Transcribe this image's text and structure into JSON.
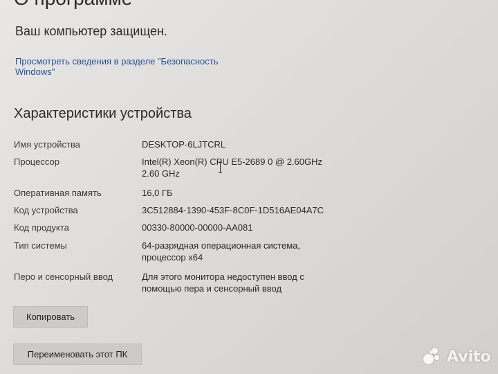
{
  "page": {
    "title": "О программе",
    "protection_status": "Ваш компьютер защищен.",
    "security_link": "Просмотреть сведения в разделе \"Безопасность Windows\""
  },
  "device_specs": {
    "section_title": "Характеристики устройства",
    "rows": [
      {
        "label": "Имя устройства",
        "value": "DESKTOP-6LJTCRL"
      },
      {
        "label": "Процессор",
        "value": "Intel(R) Xeon(R) CPU E5-2689 0 @ 2.60GHz\n2.60 GHz"
      },
      {
        "label": "Оперативная память",
        "value": "16,0 ГБ"
      },
      {
        "label": "Код устройства",
        "value": "3C512884-1390-453F-8C0F-1D516AE04A7C"
      },
      {
        "label": "Код продукта",
        "value": "00330-80000-00000-AA081"
      },
      {
        "label": "Тип системы",
        "value": "64-разрядная операционная система,\nпроцессор x64"
      },
      {
        "label": "Перо и сенсорный ввод",
        "value": "Для этого монитора недоступен ввод с\nпомощью пера и сенсорный ввод"
      }
    ]
  },
  "buttons": {
    "copy": "Копировать",
    "rename": "Переименовать этот ПК"
  },
  "watermark": {
    "text": "Avito",
    "icon": "avito-logo-icon"
  },
  "colors": {
    "link": "#1f4f9a",
    "background": "#e3e1df",
    "button": "#cccbca"
  }
}
